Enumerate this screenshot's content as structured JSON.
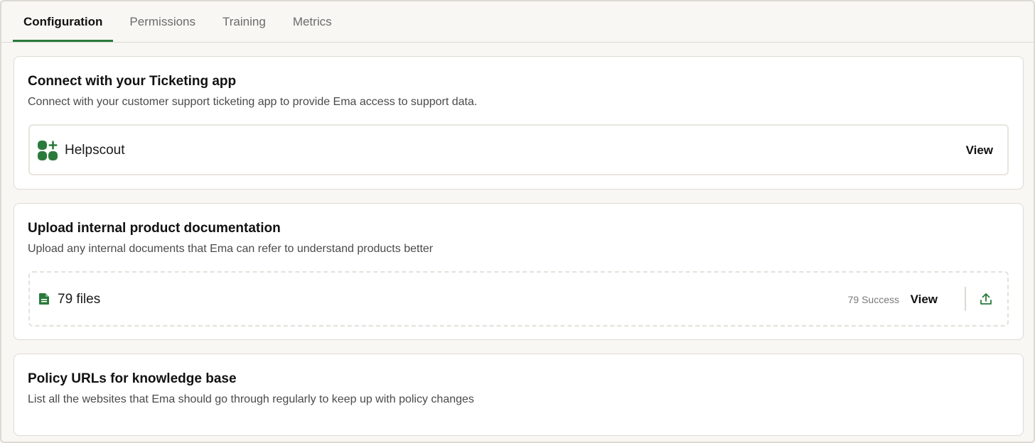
{
  "tabs": [
    {
      "label": "Configuration",
      "active": true
    },
    {
      "label": "Permissions",
      "active": false
    },
    {
      "label": "Training",
      "active": false
    },
    {
      "label": "Metrics",
      "active": false
    }
  ],
  "ticketing": {
    "title": "Connect with your Ticketing app",
    "description": "Connect with your customer support ticketing app to provide Ema access to support data.",
    "app_name": "Helpscout",
    "app_icon": "apps-add-icon",
    "view_label": "View"
  },
  "documentation": {
    "title": "Upload internal product documentation",
    "description": "Upload any internal documents that Ema can refer to understand products better",
    "files_label": "79 files",
    "file_icon": "document-icon",
    "status": "79 Success",
    "view_label": "View",
    "upload_icon": "upload-icon"
  },
  "policy": {
    "title": "Policy URLs for knowledge base",
    "description": "List all the websites that Ema should go through regularly to keep up with policy changes"
  },
  "colors": {
    "accent": "#2a7a3b",
    "background": "#f8f7f3",
    "card": "#ffffff",
    "border": "#dddbd4"
  }
}
